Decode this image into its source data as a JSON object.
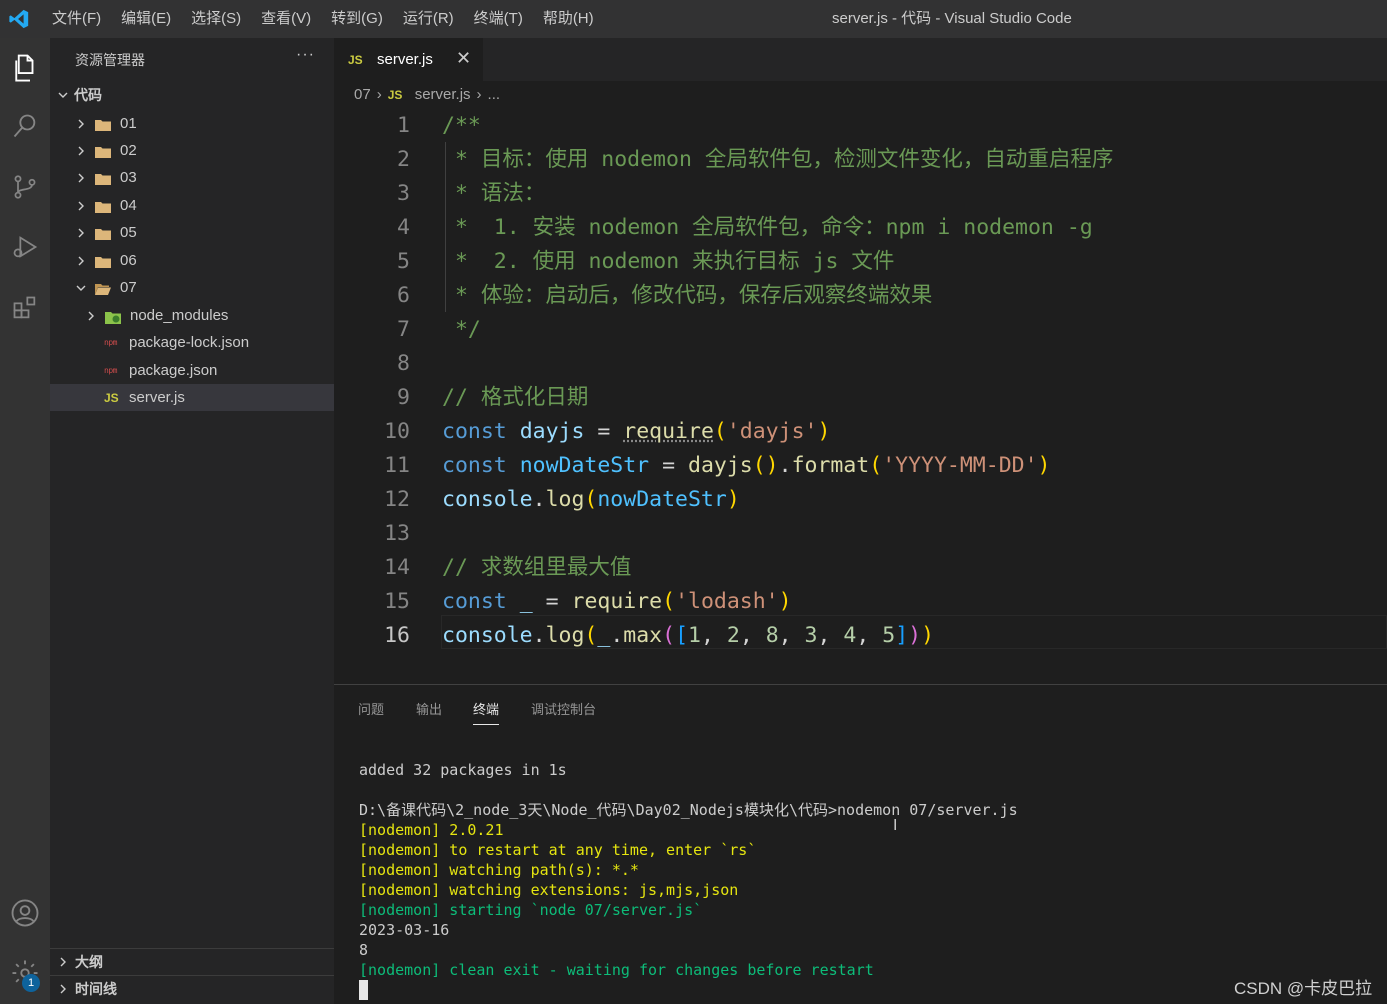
{
  "window": {
    "title": "server.js - 代码 - Visual Studio Code",
    "menus": [
      "文件(F)",
      "编辑(E)",
      "选择(S)",
      "查看(V)",
      "转到(G)",
      "运行(R)",
      "终端(T)",
      "帮助(H)"
    ]
  },
  "activity": {
    "badge": "1"
  },
  "sidebar": {
    "header": "资源管理器",
    "more": "···",
    "root": "代码",
    "items": [
      {
        "label": "01",
        "type": "folder"
      },
      {
        "label": "02",
        "type": "folder"
      },
      {
        "label": "03",
        "type": "folder"
      },
      {
        "label": "04",
        "type": "folder"
      },
      {
        "label": "05",
        "type": "folder"
      },
      {
        "label": "06",
        "type": "folder"
      },
      {
        "label": "07",
        "type": "folder-open"
      },
      {
        "label": "node_modules",
        "type": "folder"
      },
      {
        "label": "package-lock.json",
        "type": "json"
      },
      {
        "label": "package.json",
        "type": "json"
      },
      {
        "label": "server.js",
        "type": "js"
      }
    ],
    "outline": "大纲",
    "timeline": "时间线"
  },
  "editor": {
    "tab": {
      "icon": "JS",
      "label": "server.js",
      "close": "✕"
    },
    "breadcrumb": {
      "folder": "07",
      "icon": "JS",
      "file": "server.js",
      "more": "..."
    },
    "line_numbers": [
      "1",
      "2",
      "3",
      "4",
      "5",
      "6",
      "7",
      "8",
      "9",
      "10",
      "11",
      "12",
      "13",
      "14",
      "15",
      "16"
    ],
    "lines": {
      "l1": "/**",
      "l2": " * 目标：使用 nodemon 全局软件包，检测文件变化，自动重启程序",
      "l3": " * 语法：",
      "l4": " *  1. 安装 nodemon 全局软件包，命令：npm i nodemon -g",
      "l5": " *  2. 使用 nodemon 来执行目标 js 文件",
      "l6": " * 体验：启动后，修改代码，保存后观察终端效果",
      "l7": " */",
      "l9": "// 格式化日期",
      "l14": "// 求数组里最大值"
    },
    "code": {
      "const": "const",
      "dayjs": "dayjs",
      "require": "require",
      "dayjs_str": "'dayjs'",
      "nowDateStr": "nowDateStr",
      "format": "format",
      "fmt_str": "'YYYY-MM-DD'",
      "console": "console",
      "log": "log",
      "underscore": "_",
      "lodash_str": "'lodash'",
      "max": "max",
      "nums": [
        "1",
        "2",
        "8",
        "3",
        "4",
        "5"
      ]
    }
  },
  "panel": {
    "tabs": [
      "问题",
      "输出",
      "终端",
      "调试控制台"
    ],
    "active_tab": "终端",
    "terminal": {
      "added": "added 32 packages in 1s",
      "prompt": "D:\\备课代码\\2_node_3天\\Node_代码\\Day02_Nodejs模块化\\代码>nodemon 07/server.js",
      "n1": "[nodemon] 2.0.21",
      "n2": "[nodemon] to restart at any time, enter `rs`",
      "n3": "[nodemon] watching path(s): *.*",
      "n4": "[nodemon] watching extensions: js,mjs,json",
      "n5": "[nodemon] starting `node 07/server.js`",
      "out1": "2023-03-16",
      "out2": "8",
      "n6": "[nodemon] clean exit - waiting for changes before restart"
    }
  },
  "watermark": "CSDN @卡皮巴拉"
}
